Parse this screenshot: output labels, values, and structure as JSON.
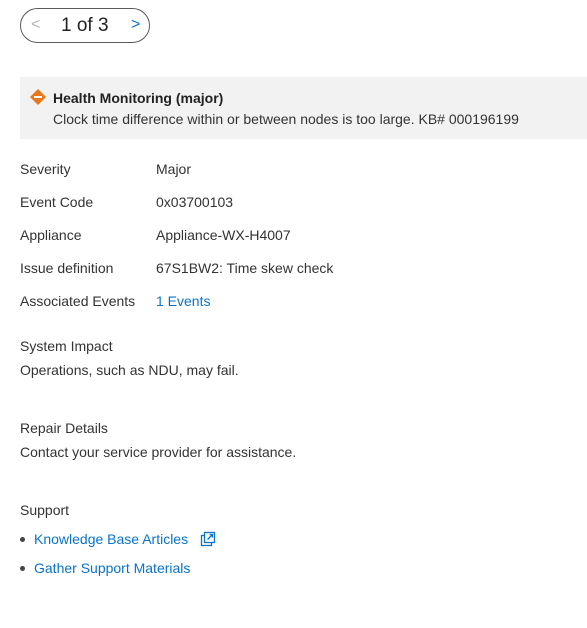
{
  "pager": {
    "prev": "<",
    "text": "1 of 3",
    "next": ">"
  },
  "banner": {
    "icon": "warning-diamond-icon",
    "title": "Health Monitoring (major)",
    "message": "Clock time difference within or between nodes is too large. KB# 000196199",
    "icon_color": "#e8781a"
  },
  "details": [
    {
      "label": "Severity",
      "value": "Major"
    },
    {
      "label": "Event Code",
      "value": "0x03700103"
    },
    {
      "label": "Appliance",
      "value": "Appliance-WX-H4007"
    },
    {
      "label": "Issue definition",
      "value": "67S1BW2: Time skew check"
    },
    {
      "label": "Associated Events",
      "value": "1 Events"
    }
  ],
  "system_impact": {
    "title": "System Impact",
    "text": "Operations, such as NDU, may fail."
  },
  "repair": {
    "title": "Repair Details",
    "text": "Contact your service provider for assistance."
  },
  "support": {
    "title": "Support",
    "links": [
      {
        "label": "Knowledge Base Articles",
        "icon": "external-link-icon"
      },
      {
        "label": "Gather Support Materials"
      }
    ]
  },
  "colors": {
    "link": "#0a73c9",
    "banner_bg": "#f2f2f2"
  }
}
